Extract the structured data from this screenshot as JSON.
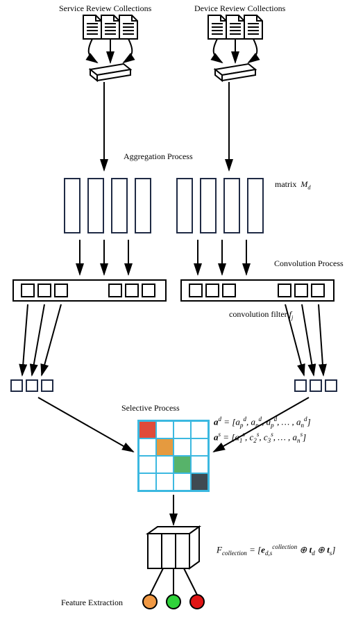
{
  "headers": {
    "service": "Service Review Collections",
    "device": "Device Review Collections"
  },
  "labels": {
    "aggregation": "Aggregation Process",
    "convolution": "Convolution Process",
    "matrixMd": "matrix  M_d",
    "convFilter": "convolution filter f_j",
    "selective": "Selective Process",
    "featureExtraction": "Feature Extraction"
  },
  "equations": {
    "ad": "a^d = [a_p^d, a_p^d, a_p^d, … , a_n^d]",
    "as": "a^s = [a_1^s, c_2^s, c_3^s, … , a_n^s]",
    "Fcollection": "F_collection = [e_{d,s}^{collection} ⊕ t_d ⊕ t_s]"
  },
  "colors": {
    "docStroke": "#000000",
    "barStroke": "#1f2a44",
    "gridStroke": "#3bb8e0",
    "selRed": "#e04b3a",
    "selOrange": "#e59a3f",
    "selGreen": "#57b36a",
    "selDkGrey": "#3f4a52",
    "dotOrange": "#f19944",
    "dotGreen": "#2fd23a",
    "dotRed": "#e01515"
  }
}
